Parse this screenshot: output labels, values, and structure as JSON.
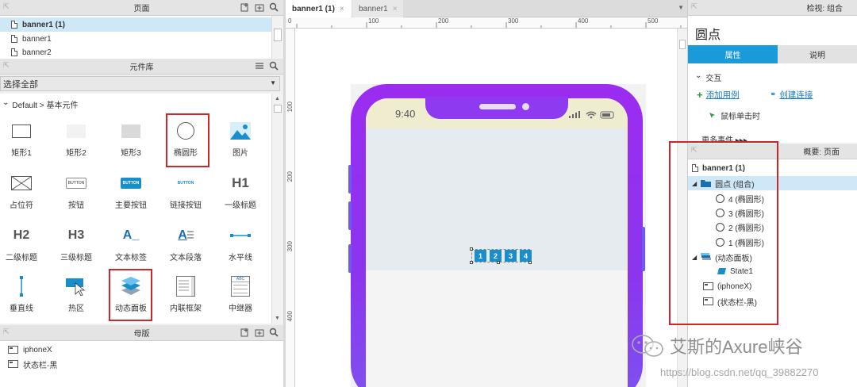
{
  "pages_panel": {
    "title": "页面",
    "items": [
      {
        "label": "banner1 (1)"
      },
      {
        "label": "banner1"
      },
      {
        "label": "banner2"
      }
    ]
  },
  "library_panel": {
    "title": "元件库",
    "select_value": "选择全部",
    "category": "Default > 基本元件",
    "widgets": [
      {
        "label": "矩形1"
      },
      {
        "label": "矩形2"
      },
      {
        "label": "矩形3"
      },
      {
        "label": "椭圆形"
      },
      {
        "label": "图片"
      },
      {
        "label": "占位符"
      },
      {
        "label": "按钮"
      },
      {
        "label": "主要按钮"
      },
      {
        "label": "链接按钮"
      },
      {
        "label": "一级标题"
      },
      {
        "label": "二级标题"
      },
      {
        "label": "三级标题"
      },
      {
        "label": "文本标签"
      },
      {
        "label": "文本段落"
      },
      {
        "label": "水平线"
      },
      {
        "label": "垂直线"
      },
      {
        "label": "热区"
      },
      {
        "label": "动态面板"
      },
      {
        "label": "内联框架"
      },
      {
        "label": "中继器"
      }
    ],
    "glyphs": {
      "button_small": "BUTTON",
      "h1": "H1",
      "h2": "H2",
      "h3": "H3",
      "text_a": "A_",
      "para_a": "A",
      "repeater": "ABC"
    }
  },
  "masters_panel": {
    "title": "母版",
    "items": [
      {
        "label": "iphoneX"
      },
      {
        "label": "状态栏-黑"
      }
    ]
  },
  "canvas": {
    "tabs": [
      {
        "label": "banner1 (1)",
        "active": true,
        "close": "×"
      },
      {
        "label": "banner1",
        "active": false,
        "close": "×"
      }
    ],
    "ruler_h": [
      "0",
      "100",
      "200",
      "300",
      "400",
      "500"
    ],
    "ruler_v": [
      "100",
      "200",
      "300",
      "400"
    ],
    "phone_time": "9:40",
    "dots": [
      "1",
      "2",
      "3",
      "4"
    ]
  },
  "inspector": {
    "header": "检视: 组合",
    "name": "圆点",
    "tabs": [
      {
        "label": "属性",
        "active": true
      },
      {
        "label": "说明",
        "active": false
      }
    ],
    "section": "交互",
    "add_case": "添加用例",
    "create_link": "创建连接",
    "event": "鼠标单击时",
    "more_events": "更多事件 ▸▸▸"
  },
  "outline": {
    "title": "概要: 页面",
    "root": "banner1 (1)",
    "rows": [
      {
        "label": "圆点 (组合)",
        "level": 1,
        "kind": "folder",
        "selected": true
      },
      {
        "label": "4 (椭圆形)",
        "level": 2,
        "kind": "circle"
      },
      {
        "label": "3 (椭圆形)",
        "level": 2,
        "kind": "circle"
      },
      {
        "label": "2 (椭圆形)",
        "level": 2,
        "kind": "circle"
      },
      {
        "label": "1 (椭圆形)",
        "level": 2,
        "kind": "circle"
      },
      {
        "label": "(动态面板)",
        "level": 1,
        "kind": "panel"
      },
      {
        "label": "State1",
        "level": 2,
        "kind": "state"
      },
      {
        "label": "(iphoneX)",
        "level": 1,
        "kind": "master"
      },
      {
        "label": "(状态栏-黑)",
        "level": 1,
        "kind": "master"
      }
    ]
  },
  "watermark": {
    "brand": "艾斯的Axure峡谷",
    "url": "https://blog.csdn.net/qq_39882270"
  },
  "colors": {
    "accent": "#1a8ecb",
    "highlight": "#d0262a",
    "phone_purple": "#9b2cf0"
  }
}
